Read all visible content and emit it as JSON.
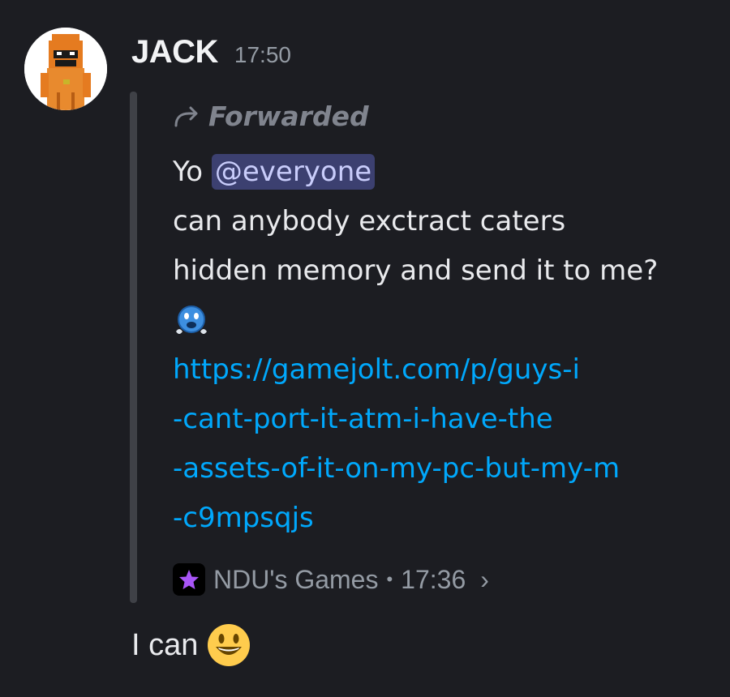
{
  "message": {
    "username": "JACK",
    "time": "17:50",
    "avatar_icon": "pixel-character-avatar",
    "forwarded": {
      "label": "Forwarded",
      "icon": "forward-arrow-icon",
      "line1_prefix": "Yo",
      "mention": "@everyone",
      "line2": "can anybody exctract caters",
      "line3": "hidden memory and send it to me?",
      "emoji": "crying-face-emoji",
      "link_lines": [
        "https://gamejolt.com/p/guys-i",
        "-cant-port-it-atm-i-have-the",
        "-assets-of-it-on-my-pc-but-my-m",
        "-c9mpsqjs"
      ],
      "source": {
        "icon": "star-icon",
        "name": "NDU's Games",
        "separator": "•",
        "time": "17:36",
        "chevron": "›"
      }
    },
    "reply": {
      "text": "I can",
      "emoji": "smiley-emoji"
    }
  },
  "colors": {
    "background": "#1c1d22",
    "link": "#00a8fc",
    "mention_bg": "#3c4070",
    "mention_text": "#c9cdfb"
  }
}
